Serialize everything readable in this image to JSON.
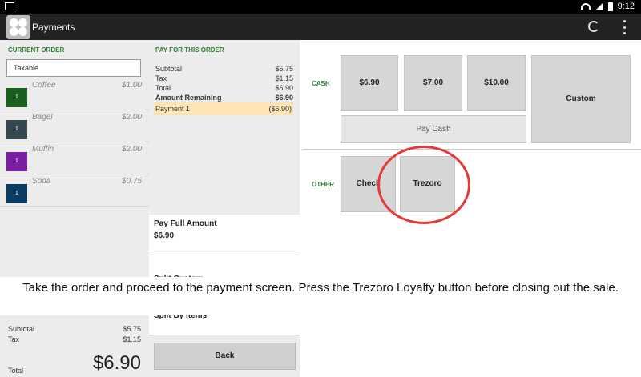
{
  "status_bar": {
    "time": "9:12"
  },
  "app_bar": {
    "title": "Payments"
  },
  "current_order": {
    "heading": "CURRENT ORDER",
    "taxable_label": "Taxable",
    "items": [
      {
        "name": "Coffee",
        "price": "$1.00",
        "qty": "1",
        "color": "#1b5e20"
      },
      {
        "name": "Bagel",
        "price": "$2.00",
        "qty": "1",
        "color": "#37474f"
      },
      {
        "name": "Muffin",
        "price": "$2.00",
        "qty": "1",
        "color": "#7b1fa2"
      },
      {
        "name": "Soda",
        "price": "$0.75",
        "qty": "1",
        "color": "#0d3c61"
      }
    ],
    "summary": {
      "subtotal_label": "Subtotal",
      "subtotal": "$5.75",
      "tax_label": "Tax",
      "tax": "$1.15",
      "total_label": "Total",
      "total": "$6.90"
    }
  },
  "pay_for_this_order": {
    "heading": "PAY FOR THIS ORDER",
    "subtotal_label": "Subtotal",
    "subtotal": "$5.75",
    "tax_label": "Tax",
    "tax": "$1.15",
    "total_label": "Total",
    "total": "$6.90",
    "remaining_label": "Amount Remaining",
    "remaining": "$6.90",
    "payment_label": "Payment 1",
    "payment": "($6.90)",
    "options": {
      "pay_full_label": "Pay Full Amount",
      "pay_full_amount": "$6.90",
      "split_custom_label": "Split Custom",
      "split_items_label": "Split By Items"
    },
    "back_label": "Back"
  },
  "tender": {
    "cash_label": "CASH",
    "cash_buttons": [
      "$6.90",
      "$7.00",
      "$10.00"
    ],
    "custom_label": "Custom",
    "pay_cash_label": "Pay Cash",
    "other_label": "OTHER",
    "check_label": "Check",
    "trezoro_label": "Trezoro"
  },
  "instruction": "Take the order and proceed to the payment screen. Press the Trezoro Loyalty button before closing out the sale.",
  "colors": {
    "accent_green": "#2e7d32",
    "highlight": "#ffe5b5",
    "annotation_red": "#e53935"
  }
}
